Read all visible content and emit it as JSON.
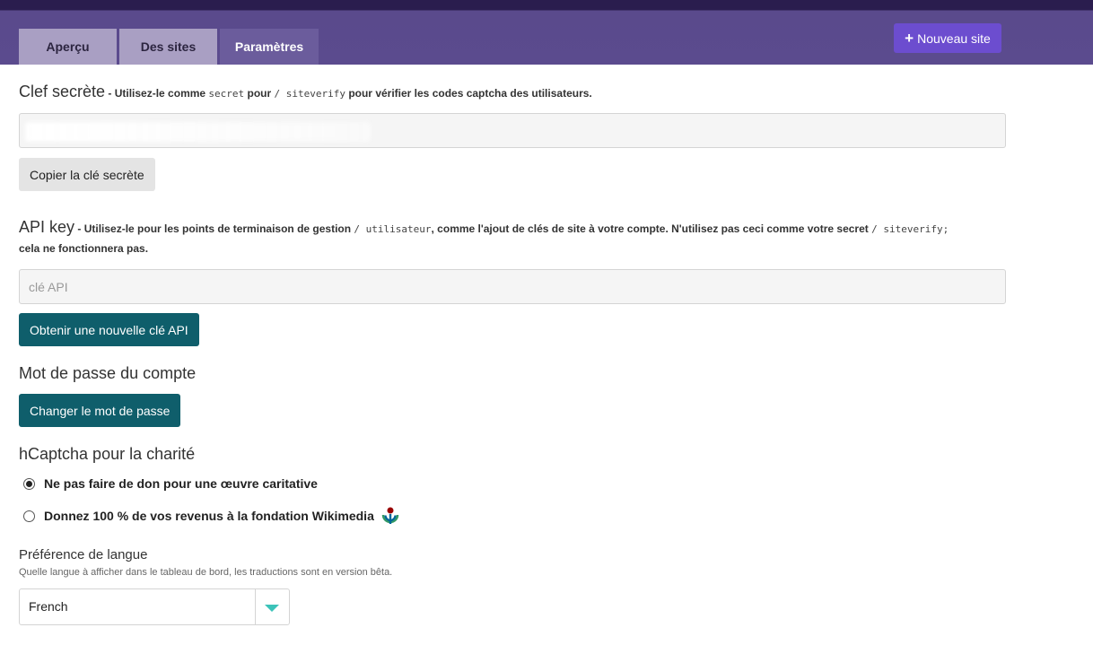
{
  "header": {
    "tabs": [
      {
        "label": "Aperçu",
        "active": false
      },
      {
        "label": "Des sites",
        "active": false
      },
      {
        "label": "Paramètres",
        "active": true
      }
    ],
    "new_site_label": "Nouveau site",
    "new_site_icon": "plus-icon"
  },
  "secret": {
    "title": "Clef secrète",
    "desc_prefix": " - Utilisez-le comme ",
    "desc_code1": "secret",
    "desc_mid": " pour ",
    "desc_code2": "/ siteverify",
    "desc_suffix": " pour vérifier les codes captcha des utilisateurs.",
    "copy_label": "Copier la clé secrète"
  },
  "api": {
    "title": "API key",
    "desc_prefix": " - Utilisez-le pour les points de terminaison de gestion ",
    "desc_code1": "/ utilisateur",
    "desc_mid": ", comme l'ajout de clés de site à votre compte. N'utilisez ",
    "desc_bold": "pas",
    "desc_mid2": " ceci comme votre secret ",
    "desc_code2": "/ siteverify;",
    "desc_line2": "cela ne fonctionnera pas.",
    "placeholder": "clé API",
    "button_label": "Obtenir une nouvelle clé API"
  },
  "password": {
    "title": "Mot de passe du compte",
    "button_label": "Changer le mot de passe"
  },
  "charity": {
    "title": "hCaptcha pour la charité",
    "options": [
      {
        "label": "Ne pas faire de don pour une œuvre caritative",
        "checked": true
      },
      {
        "label": "Donnez 100 % de vos revenus à la fondation Wikimedia",
        "checked": false
      }
    ],
    "wiki_icon": "wikimedia-icon"
  },
  "language": {
    "title": "Préférence de langue",
    "subtitle": "Quelle langue à afficher dans le tableau de bord, les traductions sont en version bêta.",
    "selected": "French"
  },
  "colors": {
    "header_bg": "#5b4b8e",
    "accent_purple": "#6c4dcf",
    "teal_button": "#0f5e6b",
    "select_arrow": "#3cc3b9"
  }
}
